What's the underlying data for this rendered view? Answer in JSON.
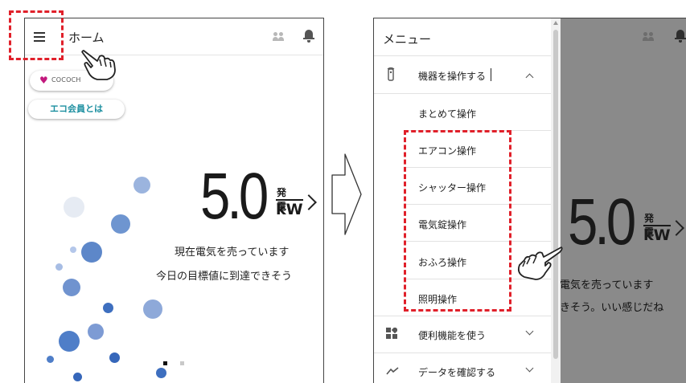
{
  "left_screen": {
    "header": {
      "title": "ホーム",
      "menu_icon": "hamburger-icon",
      "member_icon": "people-icon",
      "notification_icon": "bell-icon"
    },
    "cococh_badge": {
      "text": "COCOCH",
      "icon": "heart-icon",
      "color": "#c2187d"
    },
    "eco_button": {
      "label": "エコ会員とは",
      "color": "#1c8fa0"
    },
    "power": {
      "value": "5.0",
      "label": "発電",
      "unit": "kW"
    },
    "message_line1": "現在電気を売っています",
    "message_line2": "今日の目標値に到達できそう"
  },
  "right_screen": {
    "menu_title": "メニュー",
    "sections": [
      {
        "label": "機器を操作する",
        "icon": "remote-icon",
        "expanded": true
      },
      {
        "label": "便利機能を使う",
        "icon": "grid-icon",
        "expanded": false
      },
      {
        "label": "データを確認する",
        "icon": "chart-line-icon",
        "expanded": false
      }
    ],
    "submenu": [
      "まとめて操作",
      "エアコン操作",
      "シャッター操作",
      "電気錠操作",
      "おふろ操作",
      "照明操作"
    ],
    "background_power": {
      "value": "5.0",
      "label": "発電",
      "unit": "kW"
    },
    "background_line1": "電気を売っています",
    "background_line2": "きそう。いい感じだね"
  },
  "colors": {
    "highlight": "#e0202a",
    "bubble": "#5b86c9",
    "accent": "#1c8fa0"
  }
}
